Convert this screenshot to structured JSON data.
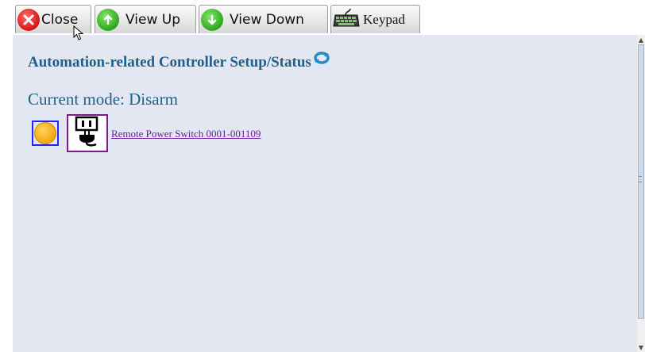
{
  "toolbar": {
    "close_label": "Close",
    "view_up_label": "View Up",
    "view_down_label": "View Down",
    "keypad_label": "Keypad"
  },
  "main": {
    "title": "Automation-related Controller Setup/Status",
    "mode_text": "Current mode: Disarm",
    "devices": [
      {
        "status": "orange-circle",
        "icon": "power-outlet-plug-icon",
        "name": "Remote Power Switch 0001-001109"
      }
    ]
  },
  "colors": {
    "panel_background": "#e2e7f1",
    "title_color": "#1f5f8b",
    "link_color": "#6a1b9a",
    "status_border": "#2323ff",
    "icon_border": "#7d1b8a",
    "status_fill": "#f5a50a"
  }
}
